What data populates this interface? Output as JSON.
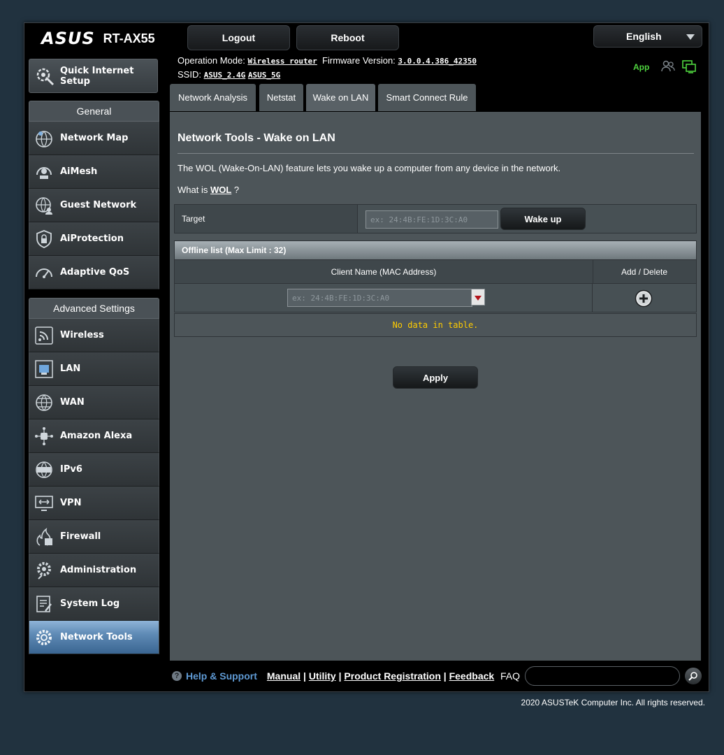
{
  "header": {
    "brand": "ASUS",
    "model": "RT-AX55",
    "logout_label": "Logout",
    "reboot_label": "Reboot",
    "language": "English",
    "operation_mode_label": "Operation Mode:",
    "operation_mode_value": "Wireless router",
    "firmware_label": "Firmware Version:",
    "firmware_value": "3.0.0.4.386_42350",
    "ssid_label": "SSID:",
    "ssid_1": "ASUS_2.4G",
    "ssid_2": "ASUS_5G",
    "app_label": "App",
    "status_icons": [
      "users-icon",
      "network-status-icon"
    ]
  },
  "sidebar": {
    "quick_setup_label": "Quick Internet Setup",
    "general_header": "General",
    "general_items": [
      {
        "label": "Network Map",
        "icon": "network-map-icon"
      },
      {
        "label": "AiMesh",
        "icon": "aimesh-icon"
      },
      {
        "label": "Guest Network",
        "icon": "guest-network-icon"
      },
      {
        "label": "AiProtection",
        "icon": "shield-icon"
      },
      {
        "label": "Adaptive QoS",
        "icon": "gauge-icon"
      }
    ],
    "advanced_header": "Advanced Settings",
    "advanced_items": [
      {
        "label": "Wireless",
        "icon": "wireless-icon"
      },
      {
        "label": "LAN",
        "icon": "lan-icon"
      },
      {
        "label": "WAN",
        "icon": "globe-icon"
      },
      {
        "label": "Amazon Alexa",
        "icon": "alexa-icon"
      },
      {
        "label": "IPv6",
        "icon": "ipv6-icon"
      },
      {
        "label": "VPN",
        "icon": "vpn-icon"
      },
      {
        "label": "Firewall",
        "icon": "firewall-icon"
      },
      {
        "label": "Administration",
        "icon": "gear-icon"
      },
      {
        "label": "System Log",
        "icon": "system-log-icon"
      },
      {
        "label": "Network Tools",
        "icon": "network-tools-icon",
        "active": true
      }
    ]
  },
  "tabs": [
    {
      "label": "Network Analysis"
    },
    {
      "label": "Netstat"
    },
    {
      "label": "Wake on LAN",
      "active": true
    },
    {
      "label": "Smart Connect Rule"
    }
  ],
  "main": {
    "title": "Network Tools - Wake on LAN",
    "description": "The WOL (Wake-On-LAN) feature lets you wake up a computer from any device in the network.",
    "what_is_prefix": "What is",
    "what_is_link": "WOL",
    "what_is_suffix": "?",
    "target_label": "Target",
    "target_placeholder": "ex: 24:4B:FE:1D:3C:A0",
    "wake_up_label": "Wake up",
    "offline_list_header": "Offline list (Max Limit : 32)",
    "col_client": "Client Name (MAC Address)",
    "col_add_delete": "Add / Delete",
    "client_placeholder": "ex: 24:4B:FE:1D:3C:A0",
    "no_data": "No data in table.",
    "apply_label": "Apply"
  },
  "footer": {
    "help_label": "Help & Support",
    "manual": "Manual",
    "utility": "Utility",
    "product_registration": "Product Registration",
    "feedback": "Feedback",
    "separator": "|",
    "faq_label": "FAQ",
    "copyright": "2020 ASUSTeK Computer Inc. All rights reserved."
  },
  "colors": {
    "background": "#21323f",
    "panel": "#4d5559",
    "accent_green": "#4fd43f",
    "help_blue": "#5f9ad4",
    "no_data_yellow": "#ffcc00",
    "active_nav": "#5f8bb6"
  }
}
